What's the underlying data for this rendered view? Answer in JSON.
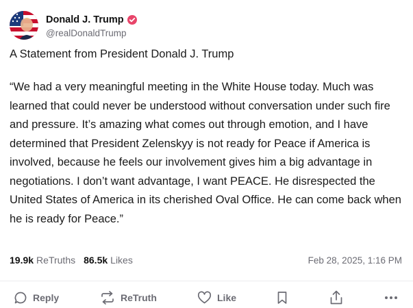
{
  "account": {
    "display_name": "Donald J. Trump",
    "handle": "@realDonaldTrump",
    "verified_color": "#e8456a"
  },
  "post": {
    "title": "A Statement from President Donald J. Trump",
    "body": "“We had a very meaningful meeting in the White House today. Much was learned that could never be understood without conversation under such fire and pressure. It’s amazing what comes out through emotion, and I have determined that President Zelenskyy is not ready for Peace if America is involved, because he feels our involvement gives him a big advantage in negotiations. I don’t want advantage, I want PEACE. He disrespected the United States of America in its cherished Oval Office. He can come back when he is ready for Peace.”",
    "retruths_count": "19.9k",
    "retruths_label": "ReTruths",
    "likes_count": "86.5k",
    "likes_label": "Likes",
    "timestamp": "Feb 28, 2025, 1:16 PM"
  },
  "actions": {
    "reply_label": "Reply",
    "retruth_label": "ReTruth",
    "like_label": "Like",
    "icons": [
      "reply-icon",
      "retruth-icon",
      "like-heart-icon",
      "bookmark-icon",
      "share-icon",
      "more-icon"
    ]
  },
  "colors": {
    "text_primary": "#111111",
    "text_secondary": "#6b6b73",
    "divider": "#ececef"
  }
}
